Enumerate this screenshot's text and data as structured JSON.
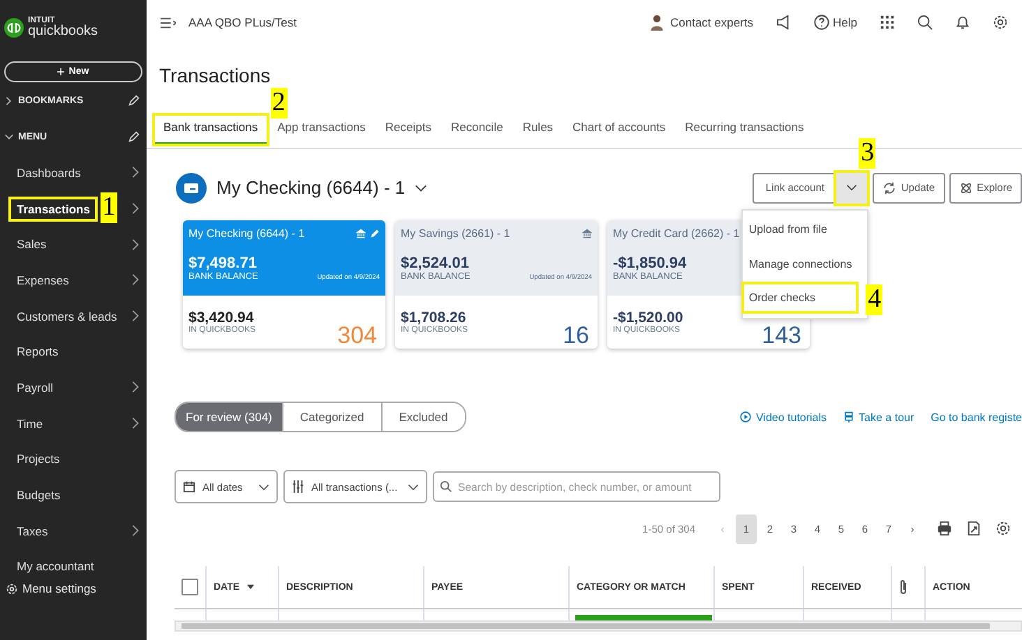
{
  "brand": {
    "top": "INTUIT",
    "name": "quickbooks"
  },
  "new_button": {
    "label": "New"
  },
  "sidebar": {
    "sections": [
      {
        "label": "BOOKMARKS",
        "expanded": false
      },
      {
        "label": "MENU",
        "expanded": true
      }
    ],
    "items": [
      {
        "label": "Dashboards",
        "has_children": true,
        "selected": false
      },
      {
        "label": "Transactions",
        "has_children": true,
        "selected": true,
        "callout": "1"
      },
      {
        "label": "Sales",
        "has_children": true,
        "selected": false
      },
      {
        "label": "Expenses",
        "has_children": true,
        "selected": false
      },
      {
        "label": "Customers & leads",
        "has_children": true,
        "selected": false
      },
      {
        "label": "Reports",
        "has_children": false,
        "selected": false
      },
      {
        "label": "Payroll",
        "has_children": true,
        "selected": false
      },
      {
        "label": "Time",
        "has_children": true,
        "selected": false
      },
      {
        "label": "Projects",
        "has_children": false,
        "selected": false
      },
      {
        "label": "Budgets",
        "has_children": false,
        "selected": false
      },
      {
        "label": "Taxes",
        "has_children": true,
        "selected": false
      },
      {
        "label": "My accountant",
        "has_children": false,
        "selected": false
      }
    ],
    "settings": "Menu settings"
  },
  "topbar": {
    "company": "AAA QBO PLus/Test",
    "contact": "Contact experts",
    "help": "Help"
  },
  "page_title": "Transactions",
  "tabs": [
    {
      "label": "Bank transactions",
      "selected": true,
      "callout": "2"
    },
    {
      "label": "App transactions",
      "selected": false
    },
    {
      "label": "Receipts",
      "selected": false
    },
    {
      "label": "Reconcile",
      "selected": false
    },
    {
      "label": "Rules",
      "selected": false
    },
    {
      "label": "Chart of accounts",
      "selected": false
    },
    {
      "label": "Recurring transactions",
      "selected": false
    }
  ],
  "account": {
    "name": "My Checking (6644) - 1"
  },
  "actions": {
    "link_account": "Link account",
    "toggle_callout": "3",
    "update": "Update",
    "explore": "Explore"
  },
  "dropdown": {
    "items": [
      {
        "label": "Upload from file"
      },
      {
        "label": "Manage connections"
      },
      {
        "label": "Order checks",
        "callout": "4"
      }
    ]
  },
  "cards": [
    {
      "name": "My Checking (6644) - 1",
      "selected": true,
      "bank_balance": "$7,498.71",
      "bank_label": "BANK BALANCE",
      "updated": "Updated on 4/9/2024",
      "qb_balance": "$3,420.94",
      "qb_label": "IN QUICKBOOKS",
      "count": "304",
      "editable": true
    },
    {
      "name": "My Savings (2661) - 1",
      "selected": false,
      "bank_balance": "$2,524.01",
      "bank_label": "BANK BALANCE",
      "updated": "Updated on 4/9/2024",
      "qb_balance": "$1,708.26",
      "qb_label": "IN QUICKBOOKS",
      "count": "16",
      "editable": false
    },
    {
      "name": "My Credit Card (2662) - 1",
      "selected": false,
      "bank_balance": "-$1,850.94",
      "bank_label": "BANK BALANCE",
      "qb_balance": "-$1,520.00",
      "qb_label": "IN QUICKBOOKS",
      "count": "143",
      "editable": false
    }
  ],
  "review_tabs": [
    {
      "label": "For review (304)",
      "selected": true
    },
    {
      "label": "Categorized",
      "selected": false
    },
    {
      "label": "Excluded",
      "selected": false
    }
  ],
  "links": [
    {
      "label": "Video tutorials",
      "kind": "video"
    },
    {
      "label": "Take a tour",
      "kind": "tour"
    },
    {
      "label": "Go to bank registe",
      "kind": "plain"
    }
  ],
  "filters": {
    "dates": "All dates",
    "transactions": "All transactions (...",
    "search_placeholder": "Search by description, check number, or amount"
  },
  "pagination": {
    "range": "1-50 of 304",
    "prev": "‹",
    "next": "›",
    "pages": [
      {
        "label": "1",
        "selected": true
      },
      {
        "label": "2",
        "selected": false
      },
      {
        "label": "3",
        "selected": false
      },
      {
        "label": "4",
        "selected": false
      },
      {
        "label": "5",
        "selected": false
      },
      {
        "label": "6",
        "selected": false
      },
      {
        "label": "7",
        "selected": false
      }
    ]
  },
  "table": {
    "select_all": {
      "checked": false
    },
    "columns": [
      {
        "label": "DATE",
        "kind": "sorted"
      },
      {
        "label": "DESCRIPTION",
        "kind": "text"
      },
      {
        "label": "PAYEE",
        "kind": "text"
      },
      {
        "label": "CATEGORY OR MATCH",
        "kind": "text"
      },
      {
        "label": "SPENT",
        "kind": "text"
      },
      {
        "label": "RECEIVED",
        "kind": "text"
      },
      {
        "kind": "attachment"
      },
      {
        "label": "ACTION",
        "kind": "text"
      }
    ]
  }
}
